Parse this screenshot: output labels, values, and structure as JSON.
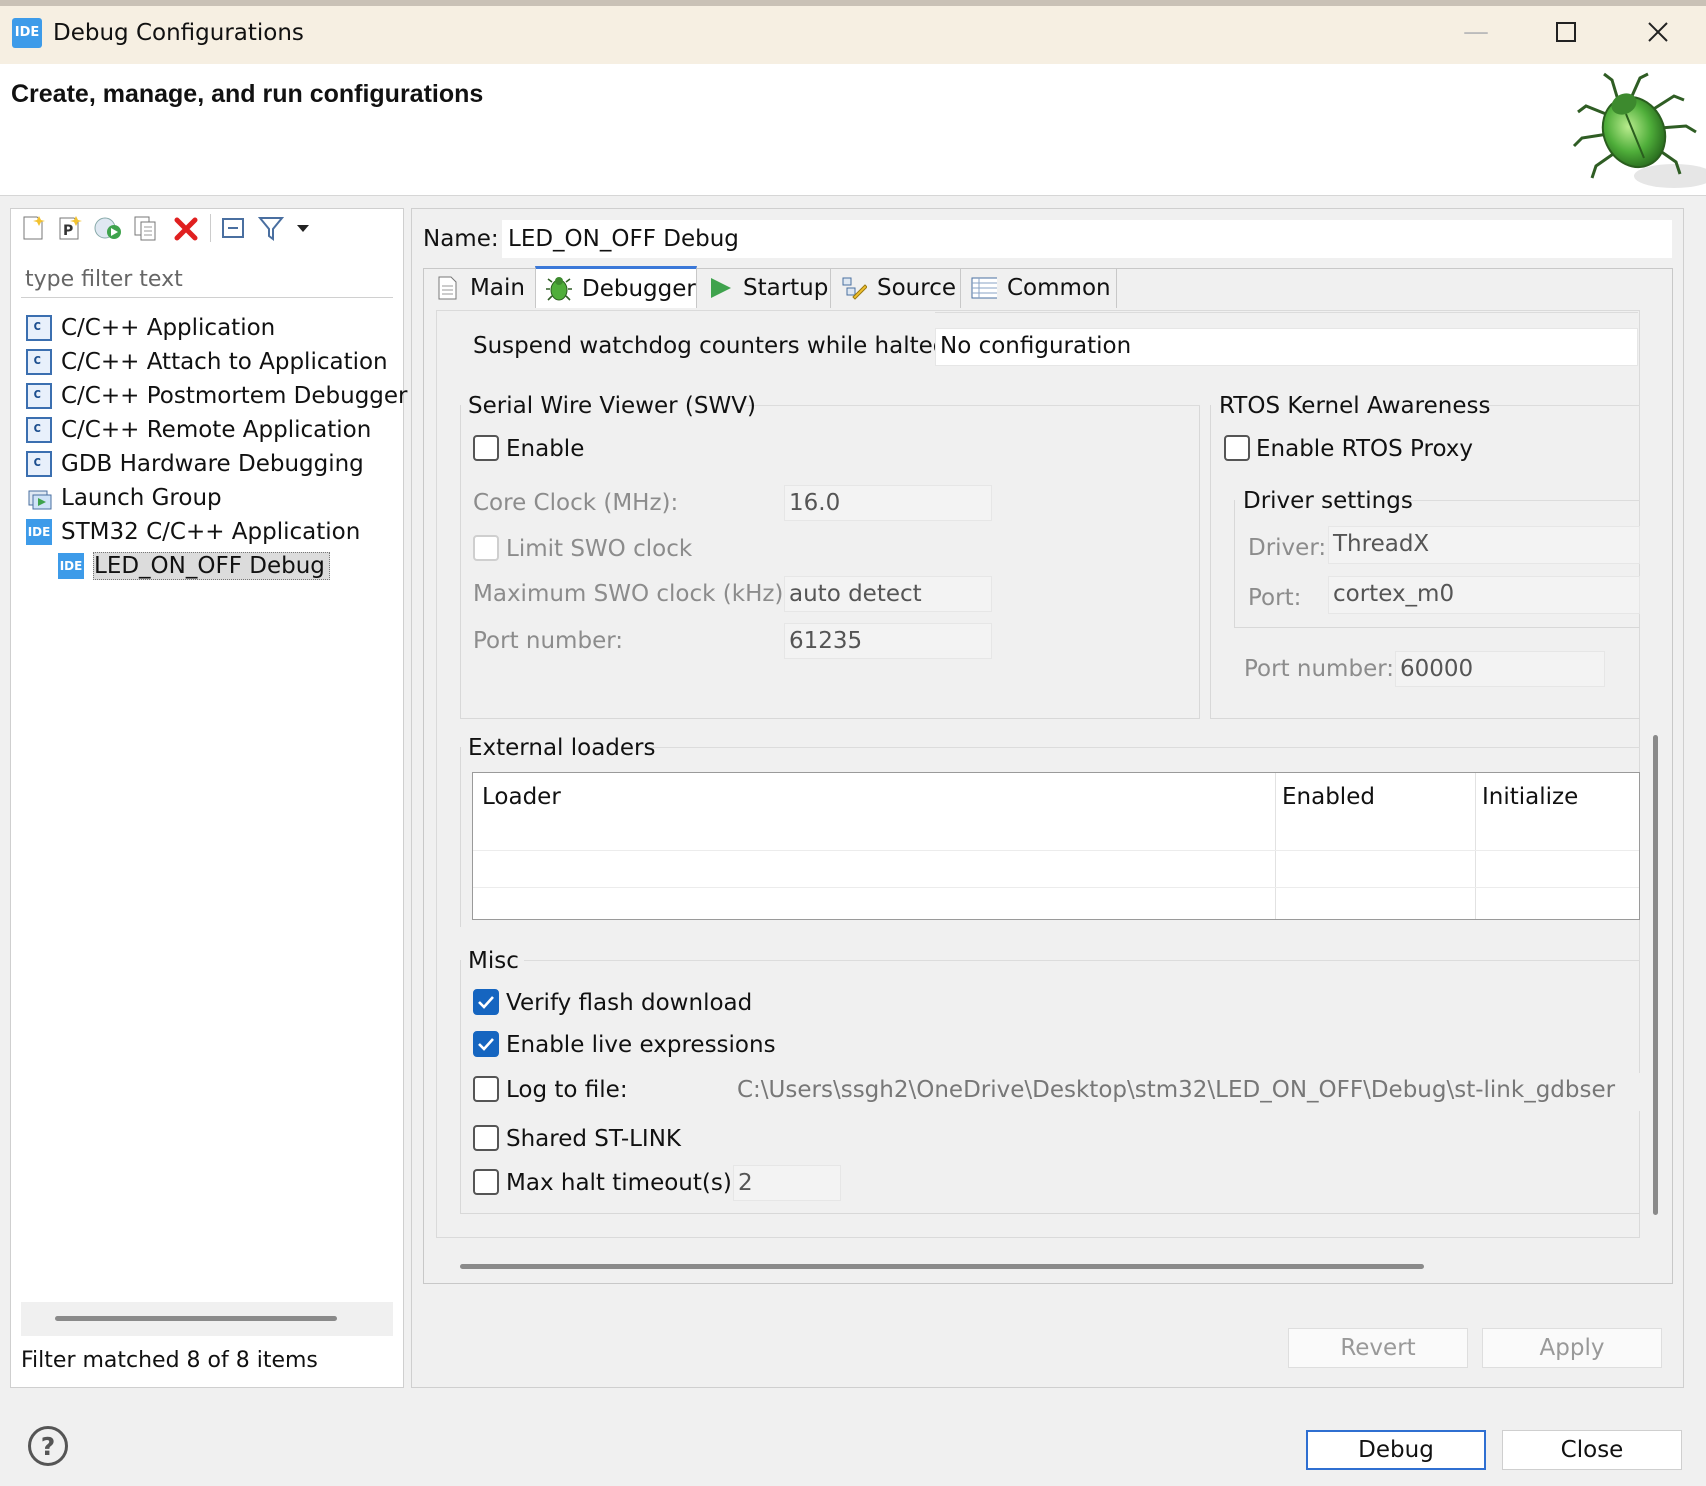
{
  "window": {
    "title": "Debug Configurations",
    "app_icon_label": "IDE",
    "header_title": "Create, manage, and run configurations"
  },
  "left": {
    "filter_placeholder": "type filter text",
    "tree": [
      {
        "label": "C/C++ Application",
        "icon": "c-config-icon"
      },
      {
        "label": "C/C++ Attach to Application",
        "icon": "c-config-icon"
      },
      {
        "label": "C/C++ Postmortem Debugger",
        "icon": "c-config-icon"
      },
      {
        "label": "C/C++ Remote Application",
        "icon": "c-config-icon"
      },
      {
        "label": "GDB Hardware Debugging",
        "icon": "c-config-icon"
      },
      {
        "label": "Launch Group",
        "icon": "launch-group-icon"
      },
      {
        "label": "STM32 C/C++ Application",
        "icon": "ide-icon"
      },
      {
        "label": "LED_ON_OFF Debug",
        "icon": "ide-icon",
        "selected": true
      }
    ],
    "status": "Filter matched 8 of 8 items"
  },
  "right": {
    "name_label": "Name:",
    "name_value": "LED_ON_OFF Debug",
    "tabs": [
      "Main",
      "Debugger",
      "Startup",
      "Source",
      "Common"
    ],
    "active_tab": "Debugger",
    "watchdog": {
      "label": "Suspend watchdog counters while halted:",
      "value": "No configuration"
    },
    "swv": {
      "title": "Serial Wire Viewer (SWV)",
      "enable_label": "Enable",
      "core_clock_label": "Core Clock (MHz):",
      "core_clock_value": "16.0",
      "limit_swo_label": "Limit SWO clock",
      "max_swo_label": "Maximum SWO clock (kHz):",
      "max_swo_value": "auto detect",
      "port_label": "Port number:",
      "port_value": "61235"
    },
    "rtos": {
      "title": "RTOS Kernel Awareness",
      "enable_label": "Enable RTOS Proxy",
      "driver_settings_title": "Driver settings",
      "driver_label": "Driver:",
      "driver_value": "ThreadX",
      "port_label": "Port:",
      "port_value": "cortex_m0",
      "port_number_label": "Port number:",
      "port_number_value": "60000"
    },
    "loaders": {
      "title": "External loaders",
      "columns": [
        "Loader",
        "Enabled",
        "Initialize"
      ]
    },
    "misc": {
      "title": "Misc",
      "verify_label": "Verify flash download",
      "verify_checked": true,
      "live_label": "Enable live expressions",
      "live_checked": true,
      "log_label": "Log to file:",
      "log_checked": false,
      "log_value": "C:\\Users\\ssgh2\\OneDrive\\Desktop\\stm32\\LED_ON_OFF\\Debug\\st-link_gdbser",
      "shared_label": "Shared ST-LINK",
      "shared_checked": false,
      "timeout_label": "Max halt timeout(s):",
      "timeout_checked": false,
      "timeout_value": "2"
    },
    "revert_label": "Revert",
    "apply_label": "Apply"
  },
  "footer": {
    "debug_label": "Debug",
    "close_label": "Close",
    "help_glyph": "?"
  },
  "colors": {
    "accent": "#1565c0",
    "titlebar": "#f6efe2",
    "ide_blue": "#3d9be9"
  }
}
